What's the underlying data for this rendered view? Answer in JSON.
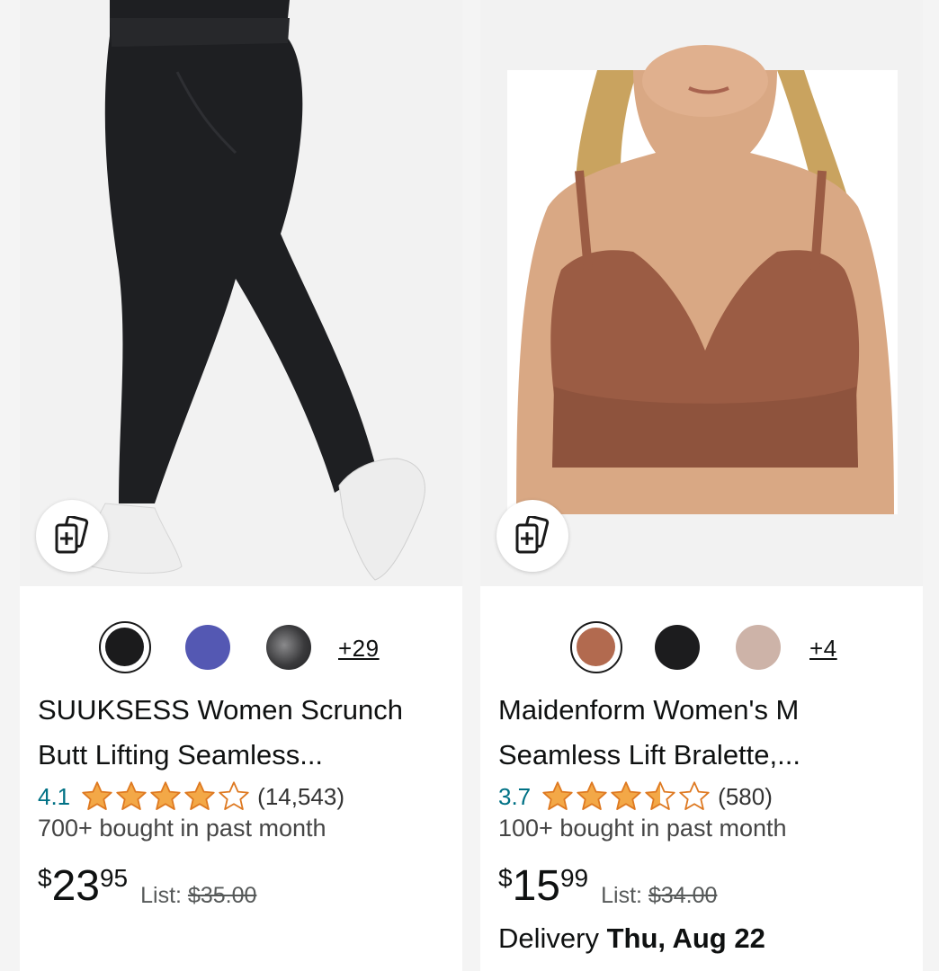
{
  "products": [
    {
      "image_alt": "",
      "compare_icon": "compare-add-icon",
      "swatches": [
        {
          "color": "#1b1b1c",
          "selected": true
        },
        {
          "color": "#5458b3",
          "selected": false
        },
        {
          "color": "#3a3a3c",
          "selected": false
        }
      ],
      "more_colors": "+29",
      "title_line1": "SUUKSESS Women Scrunch",
      "title_line2": "Butt Lifting Seamless...",
      "rating": "4.1",
      "stars": 4.0,
      "review_count": "(14,543)",
      "bought": "700+ bought in past month",
      "currency": "$",
      "price_whole": "23",
      "price_fraction": "95",
      "list_label": "List:",
      "list_price": "$35.00"
    },
    {
      "image_alt": "",
      "compare_icon": "compare-add-icon",
      "swatches": [
        {
          "color": "#b26a4f",
          "selected": true
        },
        {
          "color": "#1c1c1e",
          "selected": false
        },
        {
          "color": "#cdb3a8",
          "selected": false
        }
      ],
      "more_colors": "+4",
      "title_line1": "Maidenform Women's M",
      "title_line2": "Seamless Lift Bralette,...",
      "rating": "3.7",
      "stars": 3.5,
      "review_count": "(580)",
      "bought": "100+ bought in past month",
      "currency": "$",
      "price_whole": "15",
      "price_fraction": "99",
      "list_label": "List:",
      "list_price": "$34.00",
      "delivery_label": "Delivery",
      "delivery_date": "Thu, Aug 22"
    }
  ],
  "colors": {
    "star": "#f3a847",
    "link": "#007185",
    "text": "#0f1111"
  }
}
